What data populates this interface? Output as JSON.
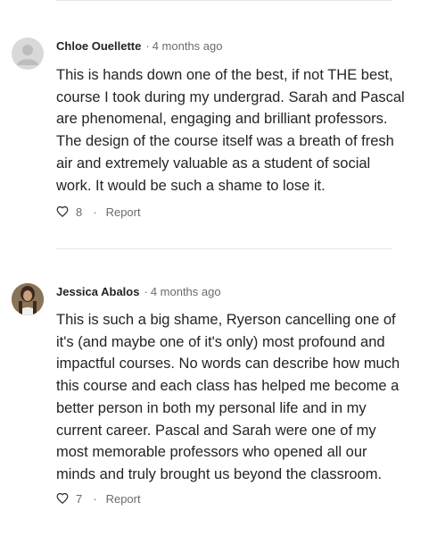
{
  "comments": [
    {
      "author": "Chloe Ouellette",
      "separator": "·",
      "time": "4 months ago",
      "lines": [
        "This is hands down one of the best, if not THE best,",
        "course I took during my undergrad. Sarah and Pascal",
        "are phenomenal, engaging and brilliant professors.",
        "The design of the course itself was a breath of fresh",
        "air and extremely valuable as a student of social",
        "work. It would be such a shame to lose it."
      ],
      "likes": "8",
      "action_separator": "·",
      "report_label": "Report"
    },
    {
      "author": "Jessica Abalos",
      "separator": "·",
      "time": "4 months ago",
      "lines": [
        "This is such a big shame, Ryerson cancelling one of",
        "it's (and maybe one of it's only) most profound and",
        "impactful courses. No words can describe how much",
        "this course and each class has helped me become a",
        "better person in both my personal life and in my",
        "current career. Pascal and Sarah were one of my",
        "most memorable professors who opened all our",
        "minds and truly brought us beyond the classroom."
      ],
      "likes": "7",
      "action_separator": "·",
      "report_label": "Report"
    }
  ]
}
